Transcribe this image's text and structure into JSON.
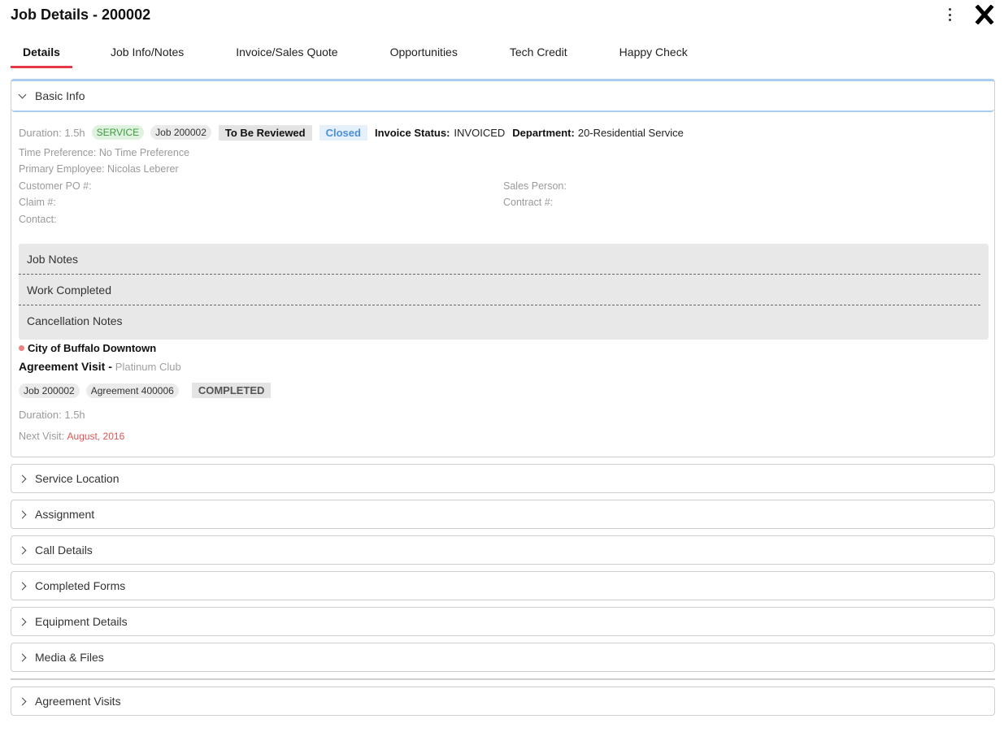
{
  "header": {
    "title": "Job Details - 200002"
  },
  "tabs": [
    {
      "label": "Details"
    },
    {
      "label": "Job Info/Notes"
    },
    {
      "label": "Invoice/Sales Quote"
    },
    {
      "label": "Opportunities"
    },
    {
      "label": "Tech Credit"
    },
    {
      "label": "Happy Check"
    }
  ],
  "basic_info": {
    "title": "Basic Info",
    "duration": "Duration: 1.5h",
    "service_tag": "SERVICE",
    "job_tag": "Job 200002",
    "review_tag": "To Be Reviewed",
    "closed_tag": "Closed",
    "invoice_status_label": "Invoice Status:",
    "invoice_status_value": "INVOICED",
    "department_label": "Department:",
    "department_value": "20-Residential Service",
    "time_preference": "Time Preference: No Time Preference",
    "primary_employee": "Primary Employee: Nicolas Leberer",
    "customer_po": "Customer PO #:",
    "sales_person": "Sales Person:",
    "claim": "Claim #:",
    "contract": "Contract #:",
    "contact": "Contact:",
    "notes": [
      "Job Notes",
      "Work Completed",
      "Cancellation Notes"
    ],
    "location": "City of Buffalo Downtown",
    "agreement_title": "Agreement Visit -",
    "agreement_sub": "Platinum Club",
    "agreement_job_tag": "Job 200002",
    "agreement_tag": "Agreement 400006",
    "completed_tag": "COMPLETED",
    "agreement_duration": "Duration: 1.5h",
    "next_visit_label": "Next Visit:",
    "next_visit_value": "August, 2016"
  },
  "sections": [
    "Service Location",
    "Assignment",
    "Call Details",
    "Completed Forms",
    "Equipment Details",
    "Media & Files",
    "Agreement Visits"
  ],
  "colors": {
    "accent_tab": "#e53945",
    "panel_border_active": "#a9cdf0",
    "service_green": "#3f9a3f",
    "closed_blue": "#4a90d9",
    "next_visit_red": "#e05555"
  }
}
